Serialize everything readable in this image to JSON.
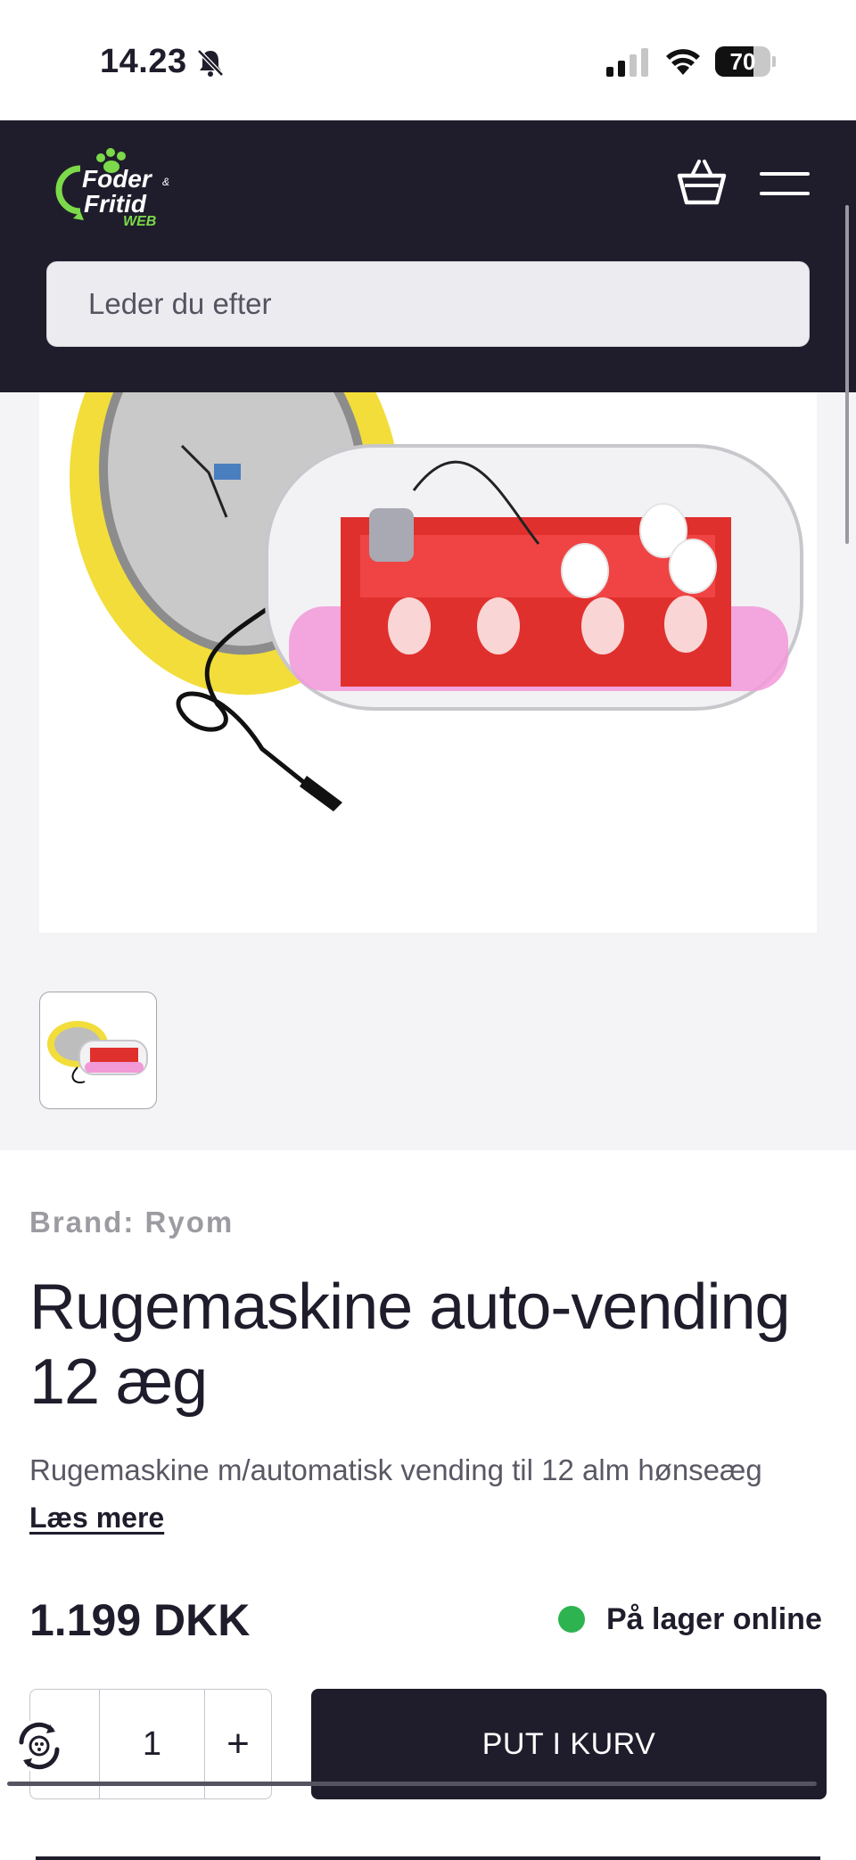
{
  "status_bar": {
    "time": "14.23",
    "battery": "70"
  },
  "header": {
    "logo": {
      "line1": "Foder",
      "line2": "Fritid",
      "line3": "WEB",
      "ampersand": "&"
    },
    "search_placeholder": "Leder du efter"
  },
  "product": {
    "brand_label": "Brand:",
    "brand_value": "Ryom",
    "title": "Rugemaskine auto-vending 12 æg",
    "description": "Rugemaskine m/automatisk vending til 12 alm hønseæg",
    "read_more": "Læs mere",
    "price": "1.199 DKK",
    "stock_status": "På lager online",
    "quantity": "1",
    "plus_label": "+",
    "add_to_cart": "PUT I KURV"
  },
  "colors": {
    "header_bg": "#1f1d2b",
    "accent_green": "#7cd94a",
    "stock_green": "#2db350"
  },
  "icons": [
    "bell-muted-icon",
    "signal-icon",
    "wifi-icon",
    "battery-icon",
    "cart-icon",
    "menu-icon",
    "widget-icon"
  ]
}
